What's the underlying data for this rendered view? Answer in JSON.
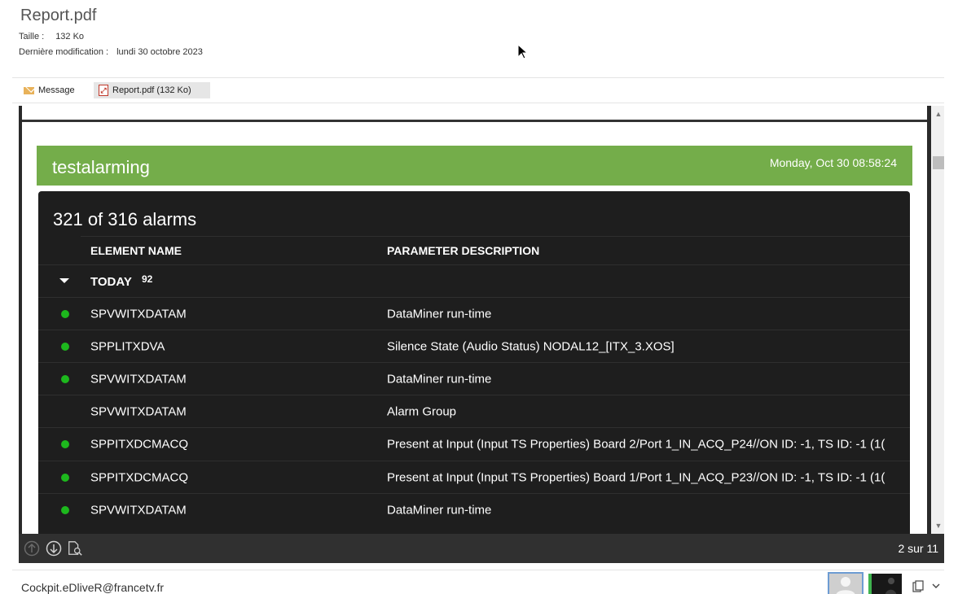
{
  "header": {
    "file_name": "Report.pdf",
    "size_label": "Taille :",
    "size_value": "132 Ko",
    "modified_label": "Dernière modification :",
    "modified_value": "lundi 30 octobre 2023"
  },
  "attachments": [
    {
      "label": "Message",
      "icon": "envelope-icon"
    },
    {
      "label": "Report.pdf (132 Ko)",
      "icon": "pdf-icon"
    }
  ],
  "report": {
    "title": "testalarming",
    "date": "Monday, Oct 30 08:58:24",
    "alarm_count": "321 of 316 alarms",
    "columns": {
      "element_name": "ELEMENT NAME",
      "parameter_description": "PARAMETER DESCRIPTION"
    },
    "group": {
      "label": "TODAY",
      "count": "92"
    },
    "rows": [
      {
        "element": "SPVWITXDATAM",
        "description": "DataMiner run-time",
        "status_dot": true
      },
      {
        "element": "SPPLITXDVA",
        "description": "Silence State (Audio Status) NODAL12_[ITX_3.XOS]",
        "status_dot": true
      },
      {
        "element": "SPVWITXDATAM",
        "description": "DataMiner run-time",
        "status_dot": true
      },
      {
        "element": "SPVWITXDATAM",
        "description": "Alarm Group",
        "status_dot": false
      },
      {
        "element": "SPPITXDCMACQ",
        "description": "Present at Input (Input TS Properties) Board 2/Port 1_IN_ACQ_P24//ON ID: -1, TS ID: -1 (1(",
        "status_dot": true
      },
      {
        "element": "SPPITXDCMACQ",
        "description": "Present at Input (Input TS Properties) Board 1/Port 1_IN_ACQ_P23//ON ID: -1, TS ID: -1 (1(",
        "status_dot": true
      },
      {
        "element": "SPVWITXDATAM",
        "description": "DataMiner run-time",
        "status_dot": true
      }
    ],
    "status_color": "#1db81d",
    "accent_color": "#74ad4a"
  },
  "viewer": {
    "page_indicator": "2 sur 11"
  },
  "footer": {
    "sender": "Cockpit.eDliveR@francetv.fr"
  }
}
